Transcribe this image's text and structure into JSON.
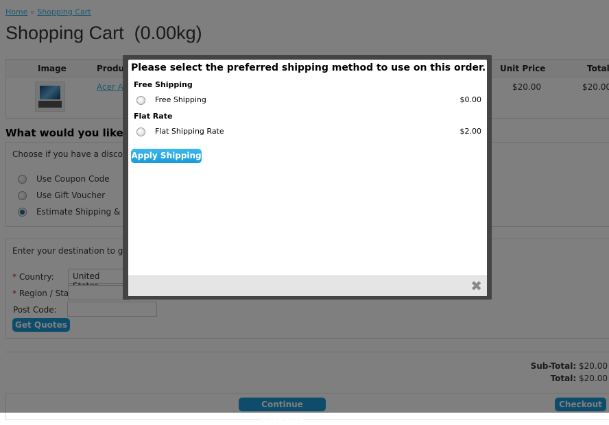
{
  "breadcrumb": {
    "home": "Home",
    "separator": "»",
    "current": "Shopping Cart"
  },
  "title": "Shopping Cart  (0.00kg)",
  "cart": {
    "headers": {
      "image": "Image",
      "product": "Product Name",
      "unit_price": "Unit Price",
      "total": "Total"
    },
    "rows": [
      {
        "product": "Acer Aspire",
        "unit_price": "$20.00",
        "total": "$20.00"
      }
    ]
  },
  "next_heading": "What would you like to do next?",
  "discount": {
    "intro": "Choose if you have a discount code or reward points you want to use or would like to estimate your delivery cost.",
    "options": [
      {
        "label": "Use Coupon Code",
        "selected": false
      },
      {
        "label": "Use Gift Voucher",
        "selected": false
      },
      {
        "label": "Estimate Shipping & Taxes",
        "selected": true
      }
    ]
  },
  "shipping_estimate": {
    "intro": "Enter your destination to get a shipping estimate.",
    "required_mark": "*",
    "country_label": "Country:",
    "country_value": "United States",
    "region_label": "Region / State:",
    "region_value": "",
    "postcode_label": "Post Code:",
    "postcode_value": "",
    "button": "Get Quotes"
  },
  "totals": {
    "subtotal_label": "Sub-Total:",
    "subtotal": "$20.00",
    "total_label": "Total:",
    "total": "$20.00"
  },
  "buttons": {
    "continue": "Continue Shopping",
    "checkout": "Checkout"
  },
  "modal": {
    "heading": "Please select the preferred shipping method to use on this order.",
    "groups": [
      {
        "title": "Free Shipping",
        "option": "Free Shipping",
        "price": "$0.00"
      },
      {
        "title": "Flat Rate",
        "option": "Flat Shipping Rate",
        "price": "$2.00"
      }
    ],
    "apply": "Apply Shipping",
    "close_icon": "close-x-icon"
  },
  "colors": {
    "accent": "#1d98d6",
    "link": "#38B0E3"
  }
}
